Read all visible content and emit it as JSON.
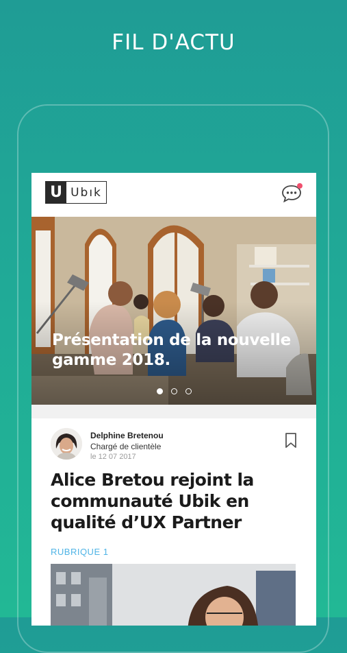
{
  "page_title": "FIL D'ACTU",
  "header": {
    "logo_mark": "U",
    "logo_text": "Ubık",
    "chat_icon": "chat-bubble-icon",
    "notification_color": "#f0506e"
  },
  "hero": {
    "title": "Présentation de la nouvelle gamme 2018.",
    "slides_total": 3,
    "active_slide": 1
  },
  "article": {
    "author": {
      "name": "Delphine Bretenou",
      "role": "Chargé de clientèle",
      "date": "le 12 07 2017"
    },
    "title": "Alice Bretou rejoint la communauté Ubik en qualité d’UX Partner",
    "rubric": "RUBRIQUE 1",
    "bookmark_icon": "bookmark-icon"
  },
  "colors": {
    "background_top": "#1f9c95",
    "background_bottom": "#22b895",
    "accent": "#4fb4e6"
  }
}
